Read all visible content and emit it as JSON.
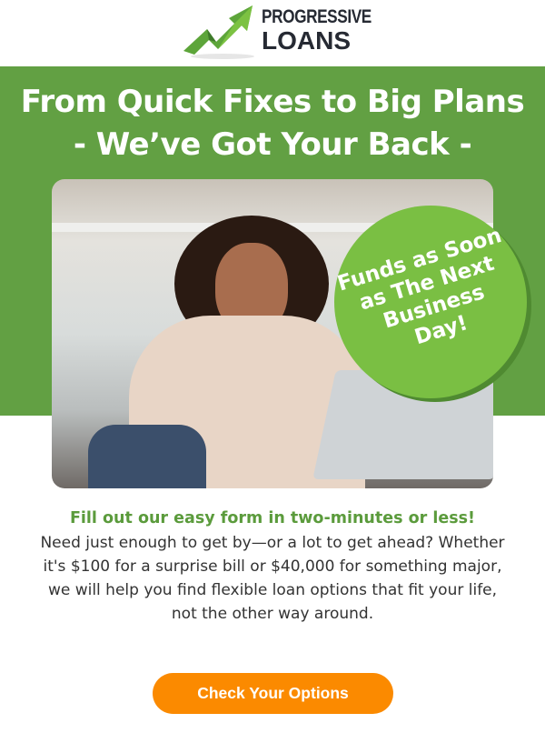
{
  "logo": {
    "line1": "PROGRESSIVE",
    "line2": "LOANS"
  },
  "hero": {
    "title_line1": "From Quick Fixes to Big Plans",
    "title_line2": "- We’ve Got Your Back -"
  },
  "badge": {
    "line1": "Funds as Soon",
    "line2": "as The Next",
    "line3": "Business",
    "line4": "Day!"
  },
  "subheading": "Fill out our easy form in two-minutes or less!",
  "body": {
    "line1": "Need just enough to get by—or a lot to get ahead? Whether",
    "line2": "it's $100 for a surprise bill or $40,000 for something major,",
    "line3": "we will help you find flexible loan options that fit your life,",
    "line4": "not the other way around."
  },
  "cta_label": "Check Your Options",
  "colors": {
    "green": "#62a043",
    "badge": "#7abf43",
    "cta": "#fb8a00"
  }
}
